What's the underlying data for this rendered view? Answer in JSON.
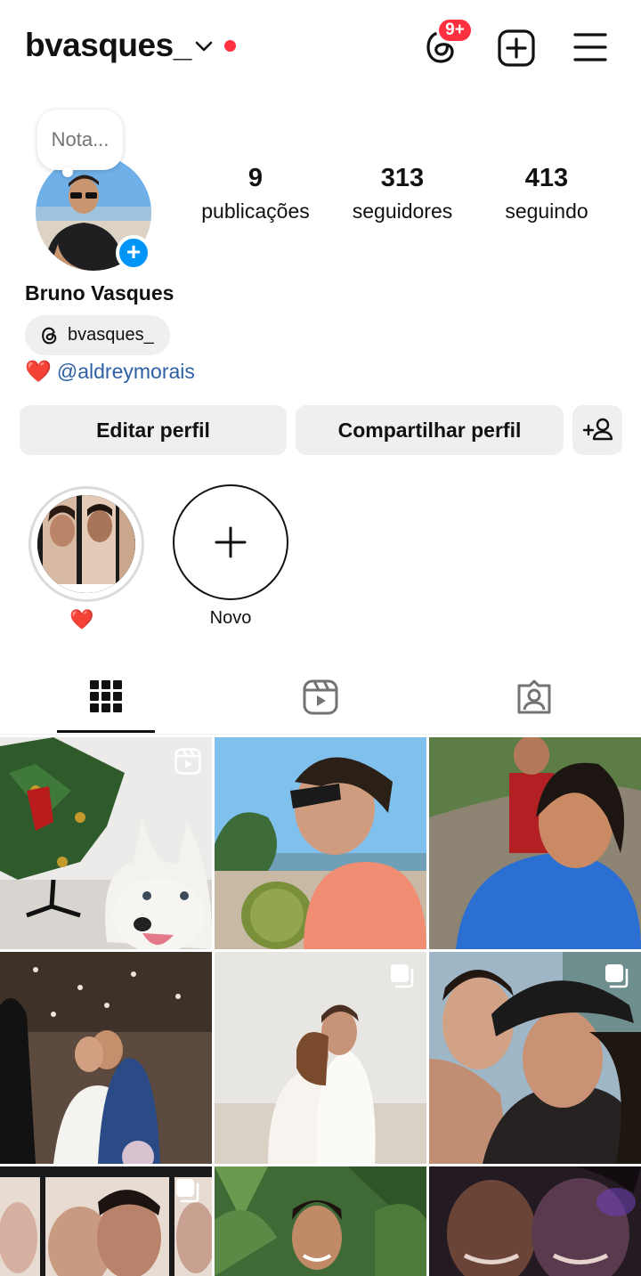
{
  "header": {
    "username": "bvasques_",
    "threads_badge": "9+",
    "colors": {
      "notification_red": "#ff3040",
      "link_blue": "#2d5fa5",
      "accent_blue": "#0095f6"
    }
  },
  "profile": {
    "note_placeholder": "Nota...",
    "full_name": "Bruno Vasques",
    "threads_handle": "bvasques_",
    "bio_emoji": "❤️",
    "bio_mention": "@aldreymorais",
    "stats": [
      {
        "value": "9",
        "label": "publicações"
      },
      {
        "value": "313",
        "label": "seguidores"
      },
      {
        "value": "413",
        "label": "seguindo"
      }
    ]
  },
  "actions": {
    "edit_profile": "Editar perfil",
    "share_profile": "Compartilhar perfil"
  },
  "highlights": [
    {
      "label": "❤️"
    },
    {
      "label": "Novo"
    }
  ],
  "tabs": [
    "posts-grid",
    "reels",
    "tagged"
  ],
  "posts": [
    {
      "kind": "reel",
      "icon": "reel-icon"
    },
    {
      "kind": "photo"
    },
    {
      "kind": "photo"
    },
    {
      "kind": "photo"
    },
    {
      "kind": "carousel",
      "icon": "carousel-icon"
    },
    {
      "kind": "carousel",
      "icon": "carousel-icon"
    },
    {
      "kind": "carousel",
      "icon": "carousel-icon"
    },
    {
      "kind": "photo"
    },
    {
      "kind": "photo"
    }
  ]
}
